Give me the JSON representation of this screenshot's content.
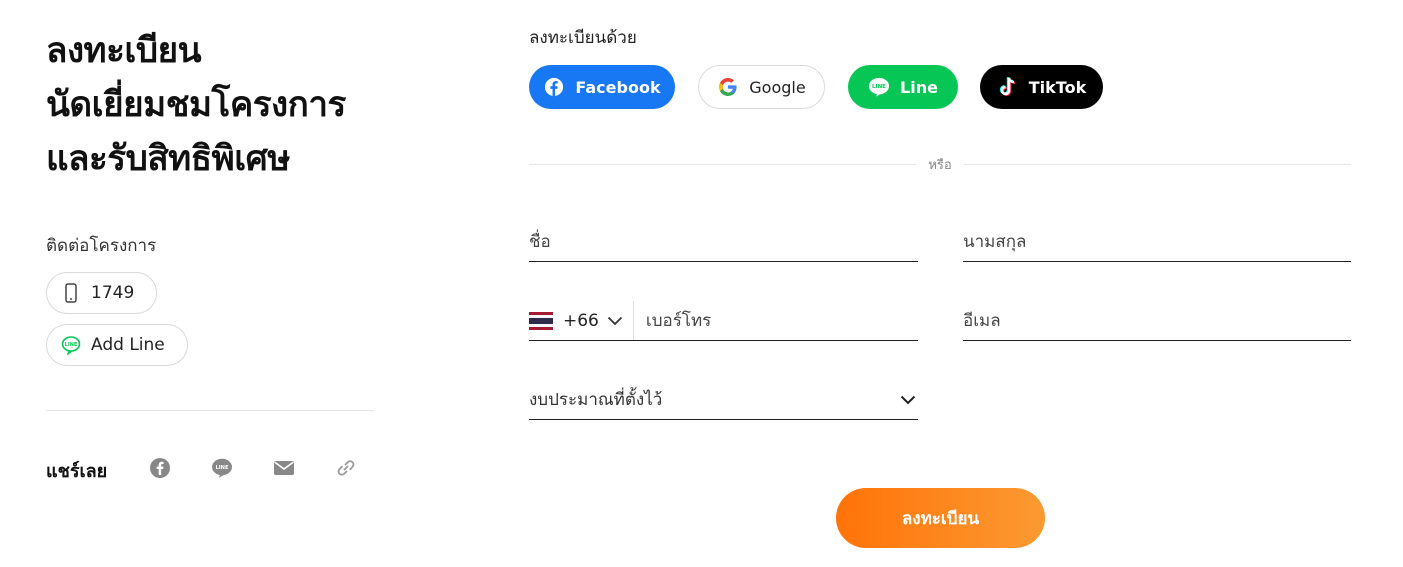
{
  "left": {
    "title_lines": [
      "ลงทะเบียน",
      "นัดเยี่ยมชมโครงการ",
      "และรับสิทธิพิเศษ"
    ],
    "contact_label": "ติดต่อโครงการ",
    "phone": {
      "label": "1749",
      "icon": "mobile-phone-icon"
    },
    "line": {
      "label": "Add Line",
      "icon": "line-icon"
    },
    "share_label": "แชร์เลย",
    "share_icons": [
      "facebook-icon",
      "line-icon",
      "mail-icon",
      "link-icon"
    ]
  },
  "form": {
    "register_with": "ลงทะเบียนด้วย",
    "social": {
      "facebook": "Facebook",
      "google": "Google",
      "line": "Line",
      "tiktok": "TikTok"
    },
    "or_text": "หรือ",
    "first_name_placeholder": "ชื่อ",
    "last_name_placeholder": "นามสกุล",
    "country_code": "+66",
    "phone_placeholder": "เบอร์โทร",
    "email_placeholder": "อีเมล",
    "budget_placeholder": "งบประมาณที่ตั้งไว้",
    "submit_label": "ลงทะเบียน"
  },
  "colors": {
    "facebook": "#1877f2",
    "line": "#06c755",
    "tiktok": "#000000",
    "submit_start": "#ff7308",
    "submit_end": "#fb9a32"
  }
}
